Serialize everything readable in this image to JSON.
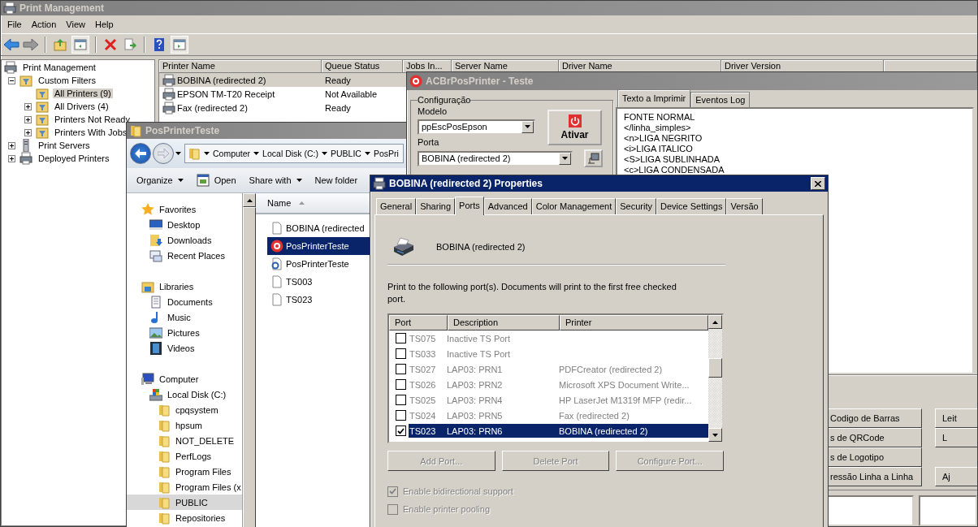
{
  "print_management": {
    "title": "Print Management",
    "menu": [
      "File",
      "Action",
      "View",
      "Help"
    ],
    "tree": [
      {
        "label": "Print Management",
        "kind": "root",
        "selected": false,
        "children": [
          {
            "label": "Custom Filters",
            "kind": "filter",
            "expanded": true,
            "selected": false,
            "children": [
              {
                "label": "All Printers (9)",
                "kind": "filter",
                "selected": true
              },
              {
                "label": "All Drivers (4)",
                "kind": "filter",
                "expanded": false,
                "selected": false
              },
              {
                "label": "Printers Not Ready",
                "kind": "filter",
                "expanded": false,
                "selected": false
              },
              {
                "label": "Printers With Jobs",
                "kind": "filter",
                "expanded": false,
                "selected": false
              }
            ]
          },
          {
            "label": "Print Servers",
            "kind": "server",
            "expanded": false,
            "selected": false
          },
          {
            "label": "Deployed Printers",
            "kind": "printer",
            "expanded": false,
            "selected": false
          }
        ]
      }
    ],
    "columns": [
      "Printer Name",
      "Queue Status",
      "Jobs In...",
      "Server Name",
      "Driver Name",
      "Driver Version"
    ],
    "printers": [
      {
        "name": "BOBINA (redirected 2)",
        "queue_status": "Ready",
        "selected": true
      },
      {
        "name": "EPSON TM-T20 Receipt",
        "queue_status": "Not Available",
        "selected": false
      },
      {
        "name": "Fax (redirected 2)",
        "queue_status": "Ready",
        "selected": false
      }
    ]
  },
  "explorer": {
    "title": "PosPrinterTeste",
    "breadcrumb": [
      "Computer",
      "Local Disk (C:)",
      "PUBLIC",
      "PosPri"
    ],
    "commands": [
      {
        "label": "Organize",
        "kind": "menu"
      },
      {
        "label": "Open",
        "kind": "icon"
      },
      {
        "label": "Share with",
        "kind": "menu"
      },
      {
        "label": "New folder",
        "kind": "plain"
      }
    ],
    "nav": [
      {
        "label": "Favorites",
        "kind": "star",
        "selected": false,
        "children": [
          {
            "label": "Desktop",
            "kind": "desktop",
            "selected": false
          },
          {
            "label": "Downloads",
            "kind": "downloads",
            "selected": false
          },
          {
            "label": "Recent Places",
            "kind": "recent",
            "selected": false
          }
        ]
      },
      {
        "label": "Libraries",
        "kind": "libraries",
        "selected": false,
        "children": [
          {
            "label": "Documents",
            "kind": "documents",
            "selected": false
          },
          {
            "label": "Music",
            "kind": "music",
            "selected": false
          },
          {
            "label": "Pictures",
            "kind": "pictures",
            "selected": false
          },
          {
            "label": "Videos",
            "kind": "videos",
            "selected": false
          }
        ]
      },
      {
        "label": "Computer",
        "kind": "computer",
        "selected": false,
        "children": [
          {
            "label": "Local Disk (C:)",
            "kind": "disk",
            "selected": false,
            "children": [
              {
                "label": "cpqsystem",
                "kind": "folder",
                "selected": false
              },
              {
                "label": "hpsum",
                "kind": "folder",
                "selected": false
              },
              {
                "label": "NOT_DELETE",
                "kind": "folder",
                "selected": false
              },
              {
                "label": "PerfLogs",
                "kind": "folder",
                "selected": false
              },
              {
                "label": "Program Files",
                "kind": "folder",
                "selected": false
              },
              {
                "label": "Program Files (x",
                "kind": "folder",
                "selected": false
              },
              {
                "label": "PUBLIC",
                "kind": "folder",
                "selected": true
              },
              {
                "label": "Repositories",
                "kind": "folder",
                "selected": false
              }
            ]
          }
        ]
      }
    ],
    "name_header": "Name",
    "files": [
      {
        "name": "BOBINA (redirected",
        "kind": "file",
        "selected": false
      },
      {
        "name": "PosPrinterTeste",
        "kind": "app",
        "selected": true
      },
      {
        "name": "PosPrinterTeste",
        "kind": "config",
        "selected": false
      },
      {
        "name": "TS003",
        "kind": "file",
        "selected": false
      },
      {
        "name": "TS023",
        "kind": "file",
        "selected": false
      }
    ]
  },
  "acbr": {
    "title": "ACBrPosPrinter - Teste",
    "group": "Configuração",
    "model_label": "Modelo",
    "model": "ppEscPosEpson",
    "activate": "Ativar",
    "port_label": "Porta",
    "port": "BOBINA (redirected 2)",
    "tabs": [
      {
        "label": "Texto a Imprimir",
        "selected": true
      },
      {
        "label": "Eventos Log",
        "selected": false
      }
    ],
    "text_lines": [
      "FONTE NORMAL",
      "</linha_simples>",
      "<n>LIGA NEGRITO",
      "<i>LIGA ITALICO",
      "<S>LIGA SUBLINHADA",
      "<c>LIGA CONDENSADA"
    ],
    "buttons_left": [
      "Codigo de Barras",
      "s de QRCode",
      "s de Logotipo",
      "ressão Linha a Linha"
    ],
    "buttons_right": [
      "Leit",
      "L",
      "Aj"
    ]
  },
  "properties": {
    "title": "BOBINA (redirected 2) Properties",
    "tabs": [
      {
        "label": "General",
        "selected": false
      },
      {
        "label": "Sharing",
        "selected": false
      },
      {
        "label": "Ports",
        "selected": true
      },
      {
        "label": "Advanced",
        "selected": false
      },
      {
        "label": "Color Management",
        "selected": false
      },
      {
        "label": "Security",
        "selected": false
      },
      {
        "label": "Device Settings",
        "selected": false
      },
      {
        "label": "Versão",
        "selected": false
      }
    ],
    "printer_name": "BOBINA (redirected 2)",
    "instructions": "Print to the following port(s). Documents will print to the first free checked port.",
    "port_columns": [
      "Port",
      "Description",
      "Printer"
    ],
    "ports": [
      {
        "port": "TS075",
        "description": "Inactive TS Port",
        "checked": false,
        "selected": false
      },
      {
        "port": "TS033",
        "description": "Inactive TS Port",
        "checked": false,
        "selected": false
      },
      {
        "port": "TS027",
        "description": "LAP03:  PRN1",
        "printer": "PDFCreator (redirected 2)",
        "checked": false,
        "selected": false
      },
      {
        "port": "TS026",
        "description": "LAP03:  PRN2",
        "printer": "Microsoft XPS Document Write...",
        "checked": false,
        "selected": false
      },
      {
        "port": "TS025",
        "description": "LAP03:  PRN4",
        "printer": "HP LaserJet M1319f MFP (redir...",
        "checked": false,
        "selected": false
      },
      {
        "port": "TS024",
        "description": "LAP03:  PRN5",
        "printer": "Fax (redirected 2)",
        "checked": false,
        "selected": false
      },
      {
        "port": "TS023",
        "description": "LAP03:  PRN6",
        "printer": "BOBINA (redirected 2)",
        "checked": true,
        "selected": true
      }
    ],
    "buttons": [
      {
        "label": "Add Port...",
        "disabled": true
      },
      {
        "label": "Delete Port",
        "disabled": true
      },
      {
        "label": "Configure Port...",
        "disabled": true
      }
    ],
    "options": [
      {
        "label": "Enable bidirectional support",
        "checked": true,
        "disabled": true
      },
      {
        "label": "Enable printer pooling",
        "checked": false,
        "disabled": true
      }
    ]
  }
}
